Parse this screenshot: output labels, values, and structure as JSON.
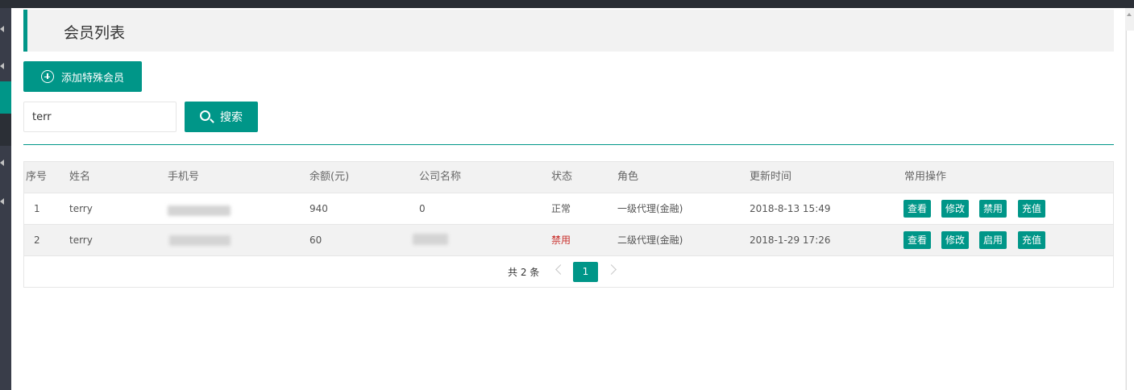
{
  "header": {
    "title": "会员列表"
  },
  "toolbar": {
    "add_label": "添加特殊会员"
  },
  "search": {
    "value": "terr",
    "button_label": "搜索"
  },
  "table": {
    "columns": [
      "序号",
      "姓名",
      "手机号",
      "余额(元)",
      "公司名称",
      "状态",
      "角色",
      "更新时间",
      "常用操作"
    ],
    "rows": [
      {
        "index": "1",
        "name": "terry",
        "phone": "",
        "balance": "940",
        "company": "0",
        "status": "正常",
        "role": "一级代理(金融)",
        "updated": "2018-8-13 15:49",
        "actions": [
          "查看",
          "修改",
          "禁用",
          "充值"
        ]
      },
      {
        "index": "2",
        "name": "terry",
        "phone": "",
        "balance": "60",
        "company": "",
        "status": "禁用",
        "role": "二级代理(金融)",
        "updated": "2018-1-29 17:26",
        "actions": [
          "查看",
          "修改",
          "启用",
          "充值"
        ]
      }
    ]
  },
  "pagination": {
    "total_text": "共 2 条",
    "current_page": "1"
  },
  "colors": {
    "accent": "#009688",
    "status_disabled": "#c9302c"
  }
}
